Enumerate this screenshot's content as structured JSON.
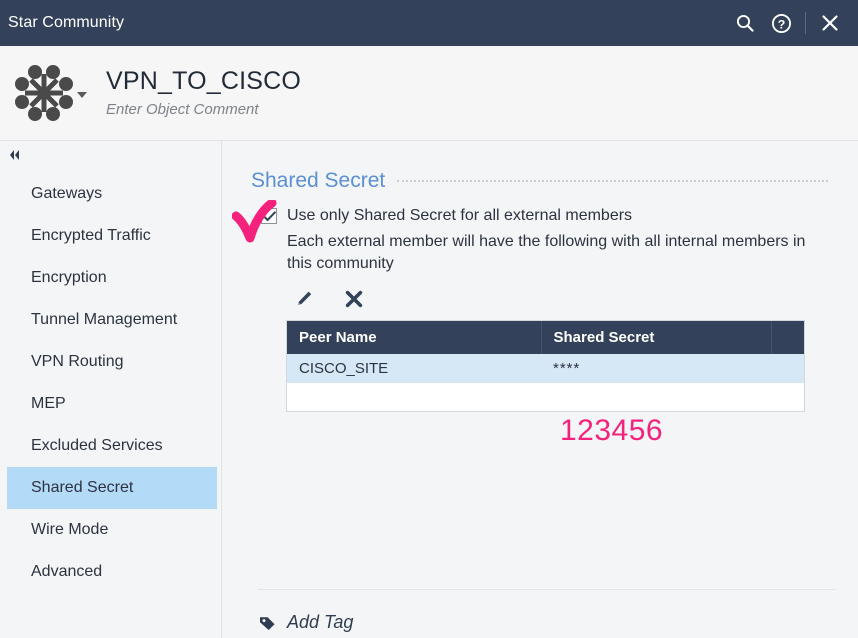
{
  "window": {
    "title": "Star Community",
    "actions": [
      {
        "name": "search-icon",
        "label": "Search"
      },
      {
        "name": "help-icon",
        "label": "Help"
      },
      {
        "name": "close-icon",
        "label": "Close"
      }
    ]
  },
  "object_header": {
    "icon": "star-community-topology-icon",
    "title": "VPN_TO_CISCO",
    "comment_placeholder": "Enter Object Comment"
  },
  "sidebar": {
    "collapse_icon": "double-chevron-left-icon",
    "items": [
      {
        "label": "Gateways",
        "selected": false
      },
      {
        "label": "Encrypted Traffic",
        "selected": false
      },
      {
        "label": "Encryption",
        "selected": false
      },
      {
        "label": "Tunnel Management",
        "selected": false
      },
      {
        "label": "VPN Routing",
        "selected": false
      },
      {
        "label": "MEP",
        "selected": false
      },
      {
        "label": "Excluded Services",
        "selected": false
      },
      {
        "label": "Shared Secret",
        "selected": true
      },
      {
        "label": "Wire Mode",
        "selected": false
      },
      {
        "label": "Advanced",
        "selected": false
      }
    ]
  },
  "main": {
    "section_title": "Shared Secret",
    "checkbox": {
      "label": "Use only Shared Secret for all external members",
      "checked": true,
      "check_glyph": "✔"
    },
    "helper_text": "Each external member will have the following with all internal members in this community",
    "toolbar": [
      {
        "name": "edit-pencil-icon",
        "label": "Edit"
      },
      {
        "name": "delete-x-icon",
        "label": "Delete"
      }
    ],
    "table": {
      "columns": [
        "Peer Name",
        "Shared Secret",
        ""
      ],
      "rows": [
        {
          "peer_name": "CISCO_SITE",
          "shared_secret": "****",
          "selected": true
        }
      ]
    }
  },
  "annotations": {
    "check_mark": {
      "name": "pink-check-annotation",
      "color": "#f5227d"
    },
    "secret_value": {
      "text": "123456",
      "color": "#f5227d"
    }
  },
  "footer": {
    "add_tag_label": "Add Tag",
    "add_tag_icon": "tag-icon"
  },
  "colors": {
    "titlebar": "#33425a",
    "accent_heading": "#5b8fd6",
    "selection": "#b3daf7",
    "row_selection": "#d6e7f6",
    "annotation": "#f5227d"
  }
}
